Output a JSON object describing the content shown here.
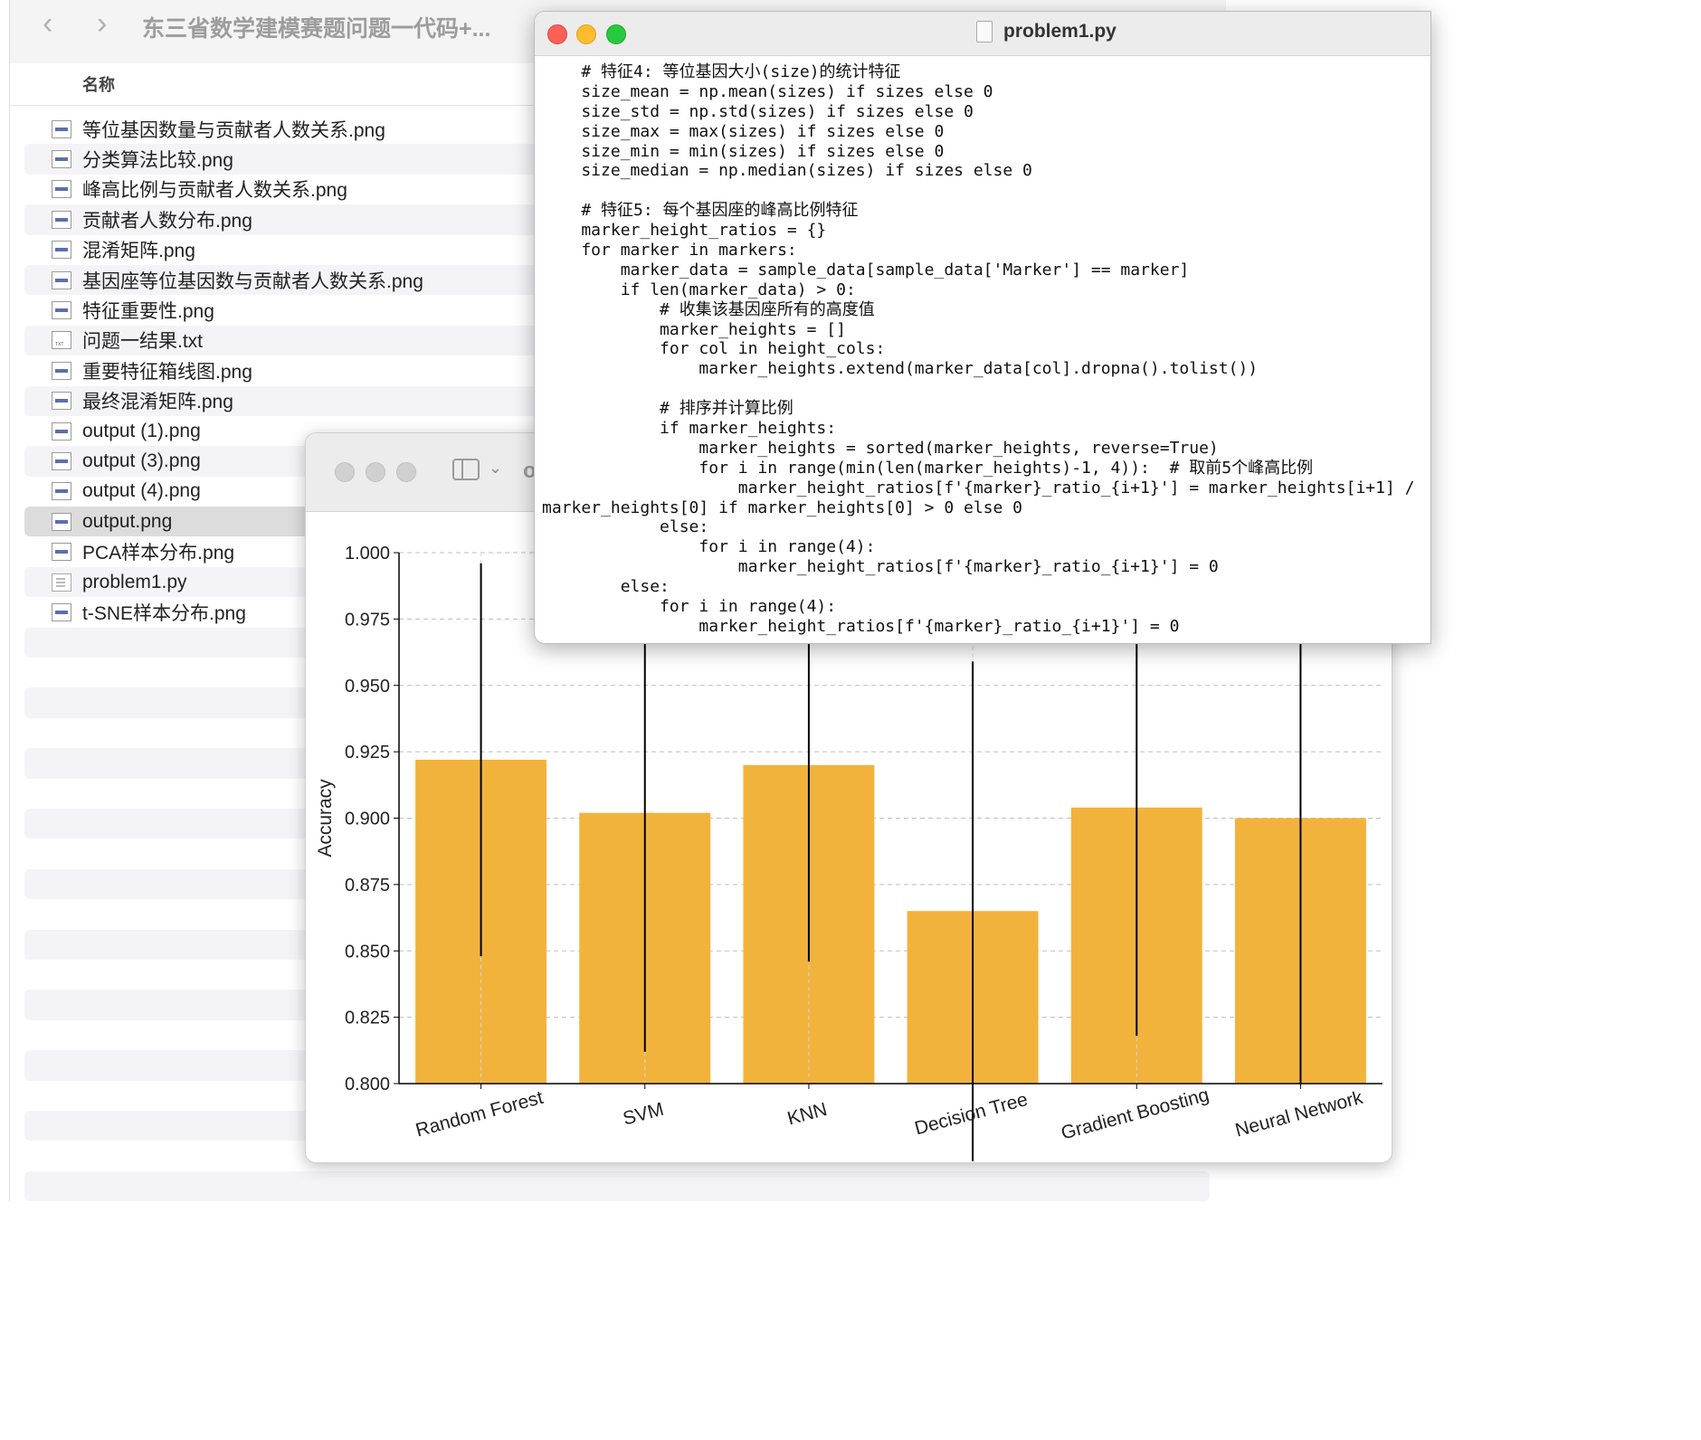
{
  "finder": {
    "title": "东三省数学建模赛题问题一代码+...",
    "back": "‹",
    "forward": "›",
    "column_name": "名称",
    "files": [
      {
        "name": "等位基因数量与贡献者人数关系.png",
        "icon": "image-file-icon"
      },
      {
        "name": "分类算法比较.png",
        "icon": "image-file-icon"
      },
      {
        "name": "峰高比例与贡献者人数关系.png",
        "icon": "image-file-icon"
      },
      {
        "name": "贡献者人数分布.png",
        "icon": "image-file-icon"
      },
      {
        "name": "混淆矩阵.png",
        "icon": "image-file-icon"
      },
      {
        "name": "基因座等位基因数与贡献者人数关系.png",
        "icon": "image-file-icon"
      },
      {
        "name": "特征重要性.png",
        "icon": "image-file-icon"
      },
      {
        "name": "问题一结果.txt",
        "icon": "text-file-icon"
      },
      {
        "name": "重要特征箱线图.png",
        "icon": "image-file-icon"
      },
      {
        "name": "最终混淆矩阵.png",
        "icon": "image-file-icon"
      },
      {
        "name": "output (1).png",
        "icon": "image-file-icon"
      },
      {
        "name": "output (3).png",
        "icon": "image-file-icon"
      },
      {
        "name": "output (4).png",
        "icon": "image-file-icon"
      },
      {
        "name": "output.png",
        "icon": "image-file-icon",
        "selected": true
      },
      {
        "name": "PCA样本分布.png",
        "icon": "image-file-icon"
      },
      {
        "name": "problem1.py",
        "icon": "python-file-icon"
      },
      {
        "name": "t-SNE样本分布.png",
        "icon": "image-file-icon"
      }
    ]
  },
  "preview": {
    "title_fragment": "o"
  },
  "code_window": {
    "title": "problem1.py",
    "lines": [
      "    # 特征4: 等位基因大小(size)的统计特征",
      "    size_mean = np.mean(sizes) if sizes else 0",
      "    size_std = np.std(sizes) if sizes else 0",
      "    size_max = max(sizes) if sizes else 0",
      "    size_min = min(sizes) if sizes else 0",
      "    size_median = np.median(sizes) if sizes else 0",
      "",
      "    # 特征5: 每个基因座的峰高比例特征",
      "    marker_height_ratios = {}",
      "    for marker in markers:",
      "        marker_data = sample_data[sample_data['Marker'] == marker]",
      "        if len(marker_data) > 0:",
      "            # 收集该基因座所有的高度值",
      "            marker_heights = []",
      "            for col in height_cols:",
      "                marker_heights.extend(marker_data[col].dropna().tolist())",
      "",
      "            # 排序并计算比例",
      "            if marker_heights:",
      "                marker_heights = sorted(marker_heights, reverse=True)",
      "                for i in range(min(len(marker_heights)-1, 4)):  # 取前5个峰高比例",
      "                    marker_height_ratios[f'{marker}_ratio_{i+1}'] = marker_heights[i+1] /",
      "marker_heights[0] if marker_heights[0] > 0 else 0",
      "            else:",
      "                for i in range(4):",
      "                    marker_height_ratios[f'{marker}_ratio_{i+1}'] = 0",
      "        else:",
      "            for i in range(4):",
      "                marker_height_ratios[f'{marker}_ratio_{i+1}'] = 0"
    ]
  },
  "colors": {
    "bar": "#f2b33d",
    "error_bar": "#000000",
    "grid": "#bfbfbf"
  },
  "chart_data": {
    "type": "bar",
    "categories": [
      "Random Forest",
      "SVM",
      "KNN",
      "Decision Tree",
      "Gradient Boosting",
      "Neural Network"
    ],
    "values": [
      0.922,
      0.902,
      0.92,
      0.865,
      0.904,
      0.9
    ],
    "error_low": [
      0.848,
      0.812,
      0.846,
      0.77,
      0.818,
      0.8
    ],
    "error_high": [
      0.996,
      0.992,
      0.994,
      0.959,
      0.99,
      1.0
    ],
    "ylabel": "Accuracy",
    "xlabel": "",
    "title": "",
    "ylim": [
      0.8,
      1.0
    ],
    "yticks": [
      "0.800",
      "0.825",
      "0.850",
      "0.875",
      "0.900",
      "0.925",
      "0.950",
      "0.975",
      "1.000"
    ],
    "grid": "horizontal dashed",
    "legend": "none"
  }
}
